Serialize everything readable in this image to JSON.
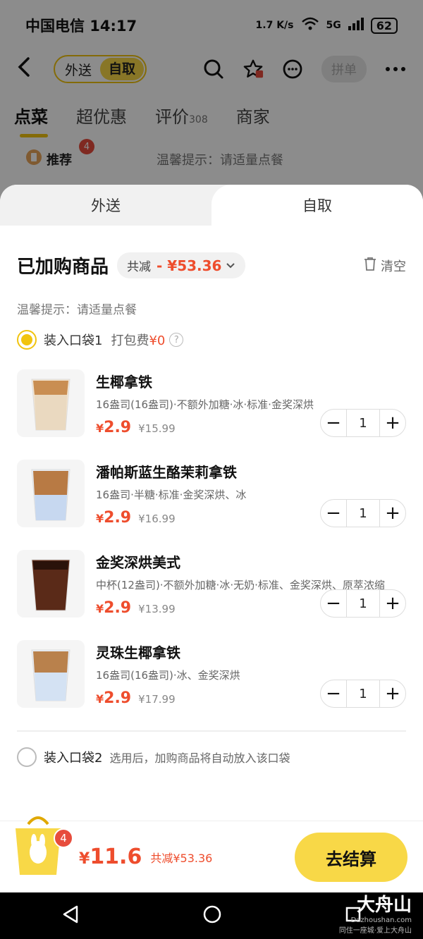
{
  "status_bar": {
    "carrier_time": "中国电信 14:17",
    "net_speed": "1.7 K/s",
    "network": "5G",
    "battery": "62"
  },
  "top_bar": {
    "mode_delivery": "外送",
    "mode_pickup": "自取",
    "group_order": "拼单"
  },
  "main_tabs": [
    {
      "label": "点菜",
      "badge": ""
    },
    {
      "label": "超优惠",
      "badge": ""
    },
    {
      "label": "评价",
      "badge": "308"
    },
    {
      "label": "商家",
      "badge": ""
    }
  ],
  "recommend": {
    "label": "推荐",
    "badge": "4",
    "tip": "温馨提示：请适量点餐"
  },
  "sheet": {
    "tab_delivery": "外送",
    "tab_pickup": "自取",
    "title": "已加购商品",
    "saving_label": "共减",
    "saving_amount": "- ¥53.36",
    "clear_label": "清空",
    "tip": "温馨提示：请适量点餐",
    "bag1": {
      "label": "装入口袋1",
      "fee_label": "打包费",
      "fee_value": "¥0"
    },
    "items": [
      {
        "name": "生椰拿铁",
        "spec": "16盎司(16盎司)·不额外加糖·冰·标准·金奖深烘",
        "price_symbol": "¥",
        "price": "2.9",
        "original": "¥15.99",
        "qty": "1"
      },
      {
        "name": "潘帕斯蓝生酪茉莉拿铁",
        "spec": "16盎司·半糖·标准·金奖深烘、冰",
        "price_symbol": "¥",
        "price": "2.9",
        "original": "¥16.99",
        "qty": "1"
      },
      {
        "name": "金奖深烘美式",
        "spec": "中杯(12盎司)·不额外加糖·冰·无奶·标准、金奖深烘、原萃浓缩",
        "price_symbol": "¥",
        "price": "2.9",
        "original": "¥13.99",
        "qty": "1"
      },
      {
        "name": "灵珠生椰拿铁",
        "spec": "16盎司(16盎司)·冰、金奖深烘",
        "price_symbol": "¥",
        "price": "2.9",
        "original": "¥17.99",
        "qty": "1"
      }
    ],
    "bag2": {
      "label": "装入口袋2",
      "note": "选用后，加购商品将自动放入该口袋"
    }
  },
  "checkout": {
    "bag_count": "4",
    "total_symbol": "¥",
    "total": "11.6",
    "total_saving": "共减¥53.36",
    "pay_label": "去结算"
  },
  "watermark": {
    "title": "大舟山",
    "domain": "Dazhoushan.com",
    "slogan": "同住一座城·爱上大舟山"
  },
  "colors": {
    "accent_yellow": "#F8D847",
    "price_red": "#EE4D2D"
  }
}
